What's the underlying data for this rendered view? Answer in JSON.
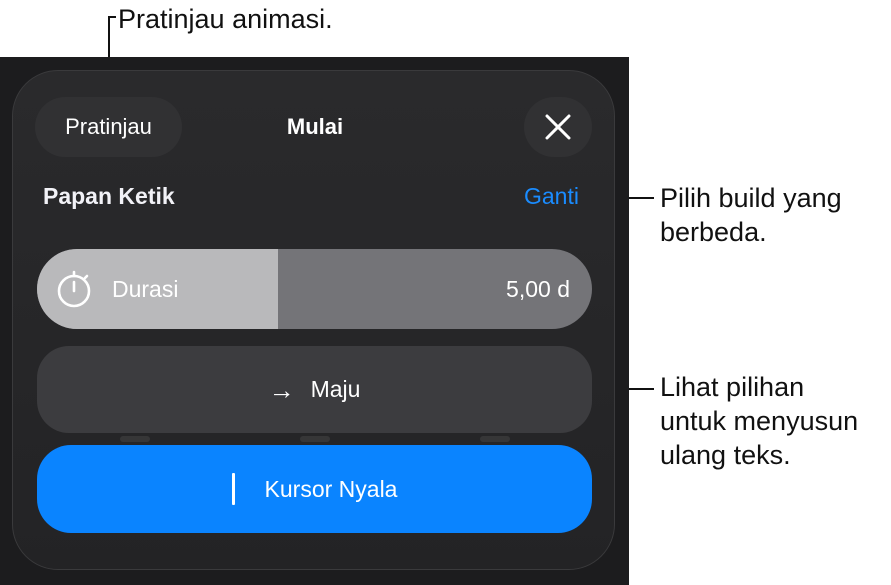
{
  "callouts": {
    "preview": "Pratinjau animasi.",
    "build_line1": "Pilih build yang",
    "build_line2": "berbeda.",
    "reorder_line1": "Lihat pilihan",
    "reorder_line2": "untuk menyusun",
    "reorder_line3": "ulang teks."
  },
  "header": {
    "preview_label": "Pratinjau",
    "title": "Mulai",
    "close_icon": "close-icon"
  },
  "effect": {
    "name": "Papan Ketik",
    "change_label": "Ganti"
  },
  "duration": {
    "icon": "stopwatch-icon",
    "label": "Durasi",
    "value": "5,00 d",
    "fill_fraction": 0.435
  },
  "direction": {
    "icon": "arrow-right-icon",
    "label": "Maju"
  },
  "delivery": {
    "icon": "cursor-icon",
    "label": "Kursor Nyala"
  },
  "colors": {
    "accent": "#0a84ff",
    "link": "#1a8cff",
    "panel": "#2a2a2c"
  }
}
